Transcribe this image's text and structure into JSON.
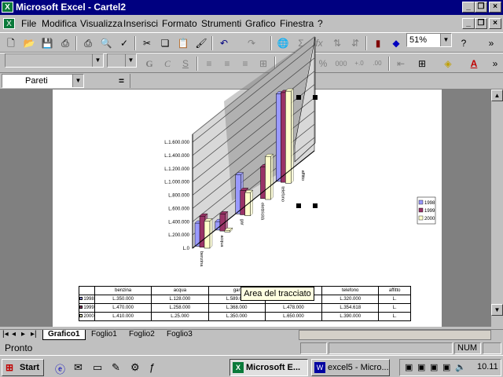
{
  "window": {
    "title": "Microsoft Excel - Cartel2",
    "app_icon": "excel-icon"
  },
  "menu": [
    "File",
    "Modifica",
    "Visualizza",
    "Inserisci",
    "Formato",
    "Strumenti",
    "Grafico",
    "Finestra",
    "?"
  ],
  "toolbar": {
    "zoom": "51%"
  },
  "formula_bar": {
    "name_box": "Pareti",
    "equals": "="
  },
  "chart_data": {
    "type": "bar",
    "categories": [
      "benzina",
      "acqua",
      "gar",
      "elettricità",
      "telefono",
      "affitto"
    ],
    "series": [
      {
        "name": "1998",
        "values": [
          350000,
          128000,
          589000,
          0,
          1320000,
          0
        ],
        "color": "#9999ff"
      },
      {
        "name": "1999",
        "values": [
          470000,
          258000,
          368000,
          478000,
          1354618,
          0
        ],
        "color": "#993366"
      },
      {
        "name": "2000",
        "values": [
          410000,
          25000,
          350000,
          650000,
          1390000,
          0
        ],
        "color": "#ffffcc"
      }
    ],
    "y_ticks": [
      "L.0",
      "L.200.000",
      "L.400.000",
      "L.600.000",
      "L.800.000",
      "L.1.000.000",
      "L.1.200.000",
      "L.1.400.000",
      "L.1.600.000"
    ],
    "ylim": [
      0,
      1600000
    ],
    "legend": [
      "1998",
      "1999",
      "2000"
    ],
    "legend_position": "right",
    "grid": true
  },
  "table": {
    "headers": [
      "benzina",
      "acqua",
      "gar",
      "elettricità",
      "telefono",
      "affitto"
    ],
    "rows": [
      {
        "label": "1998",
        "cells": [
          "L.350.000",
          "L.128.000",
          "L.589.000",
          "",
          "L.320.000",
          "L."
        ]
      },
      {
        "label": "1999",
        "cells": [
          "L.470.000",
          "L.258.000",
          "L.368.000",
          "L.478.000",
          "L.354.618",
          "L."
        ]
      },
      {
        "label": "2000",
        "cells": [
          "L.410.000",
          "L.25.000",
          "L.350.000",
          "L.650.000",
          "L.390.000",
          "L."
        ]
      }
    ]
  },
  "tooltip": "Area del tracciato",
  "sheets": [
    "Grafico1",
    "Foglio1",
    "Foglio2",
    "Foglio3"
  ],
  "status": {
    "left": "Pronto",
    "num": "NUM"
  },
  "taskbar": {
    "start": "Start",
    "tasks": [
      "Microsoft E...",
      "excel5 - Micro..."
    ],
    "clock": "10.11"
  }
}
